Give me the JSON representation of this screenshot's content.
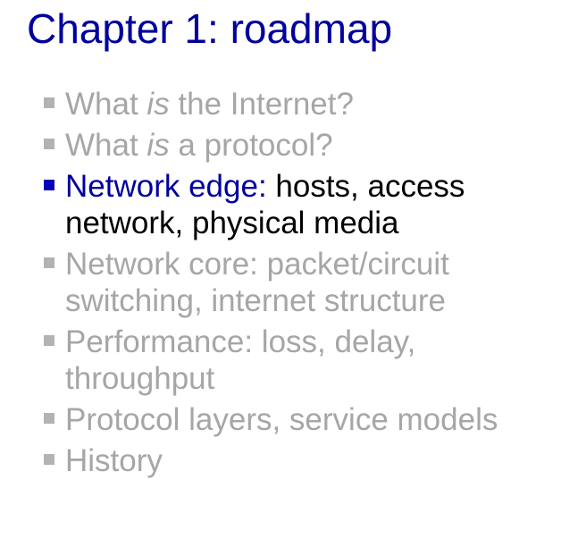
{
  "title": "Chapter 1: roadmap",
  "colors": {
    "title": "#00009c",
    "active_bullet": "#0000b8",
    "inactive_text": "#a6a6a6",
    "inactive_bullet": "#b3b3b3",
    "active_text": "#000000"
  },
  "items": [
    {
      "pre": "What ",
      "em": "is",
      "post": " the Internet?",
      "active": false
    },
    {
      "pre": "What ",
      "em": "is",
      "post": " a protocol?",
      "active": false
    },
    {
      "highlight": "Network edge:",
      "line1": " hosts, access",
      "line2": "network, physical media",
      "active": true
    },
    {
      "line1": "Network core: packet/circuit",
      "line2": "switching, internet structure",
      "active": false
    },
    {
      "line1": "Performance: loss, delay,",
      "line2": "throughput",
      "active": false
    },
    {
      "line1": "Protocol layers, service models",
      "active": false
    },
    {
      "line1": "History",
      "active": false
    }
  ]
}
